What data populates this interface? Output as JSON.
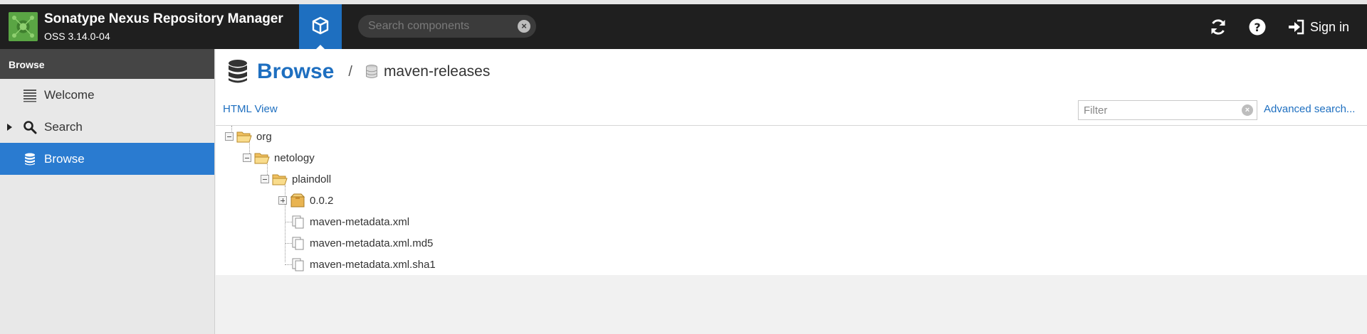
{
  "header": {
    "app_title": "Sonatype Nexus Repository Manager",
    "app_version": "OSS 3.14.0-04",
    "browse_mode_icon": "cube-icon",
    "search": {
      "placeholder": "Search components",
      "value": ""
    },
    "signin_label": "Sign in",
    "accent_color": "#1e6fc0"
  },
  "sidebar": {
    "section_title": "Browse",
    "items": [
      {
        "label": "Welcome",
        "icon": "list-icon",
        "active": false
      },
      {
        "label": "Search",
        "icon": "magnifier-icon",
        "active": false,
        "expandable": true
      },
      {
        "label": "Browse",
        "icon": "database-icon",
        "active": true
      }
    ]
  },
  "main": {
    "breadcrumb": {
      "title": "Browse",
      "separator": "/",
      "repository": "maven-releases"
    },
    "html_view_link": "HTML View",
    "filter": {
      "placeholder": "Filter",
      "value": ""
    },
    "advanced_search_link": "Advanced search...",
    "tree": [
      {
        "label": "org",
        "type": "folder-open",
        "depth": 0,
        "toggle": "minus"
      },
      {
        "label": "netology",
        "type": "folder-open",
        "depth": 1,
        "toggle": "minus"
      },
      {
        "label": "plaindoll",
        "type": "folder-open",
        "depth": 2,
        "toggle": "minus"
      },
      {
        "label": "0.0.2",
        "type": "component",
        "depth": 3,
        "toggle": "plus"
      },
      {
        "label": "maven-metadata.xml",
        "type": "file",
        "depth": 3
      },
      {
        "label": "maven-metadata.xml.md5",
        "type": "file",
        "depth": 3
      },
      {
        "label": "maven-metadata.xml.sha1",
        "type": "file",
        "depth": 3
      }
    ]
  }
}
